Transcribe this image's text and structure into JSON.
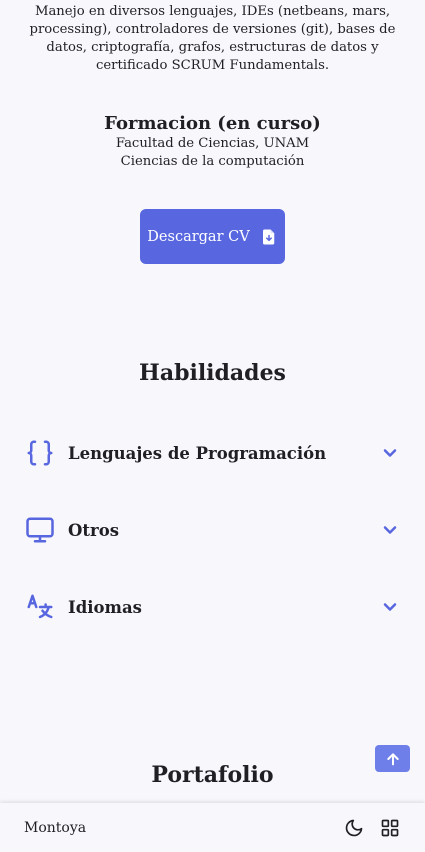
{
  "about": {
    "text": "Manejo en diversos lenguajes, IDEs (netbeans, mars, processing), controladores de versiones (git), bases de datos, criptografía, grafos, estructuras de datos y certificado SCRUM Fundamentals."
  },
  "education": {
    "title": "Formacion (en curso)",
    "school": "Facultad de Ciencias, UNAM",
    "degree": "Ciencias de la computación"
  },
  "cv_button": {
    "label": "Descargar CV",
    "icon": "download-file-icon"
  },
  "skills": {
    "title": "Habilidades",
    "items": [
      {
        "label": "Lenguajes de Programación",
        "icon": "braces-icon"
      },
      {
        "label": "Otros",
        "icon": "monitor-icon"
      },
      {
        "label": "Idiomas",
        "icon": "translate-icon"
      }
    ]
  },
  "portfolio": {
    "title": "Portafolio"
  },
  "bottom_nav": {
    "brand": "Montoya",
    "theme_icon": "moon-icon",
    "menu_icon": "grid-icon"
  },
  "colors": {
    "accent": "#5867e0",
    "background": "#f8f7fb",
    "scroll_button": "#6f7fe9"
  }
}
